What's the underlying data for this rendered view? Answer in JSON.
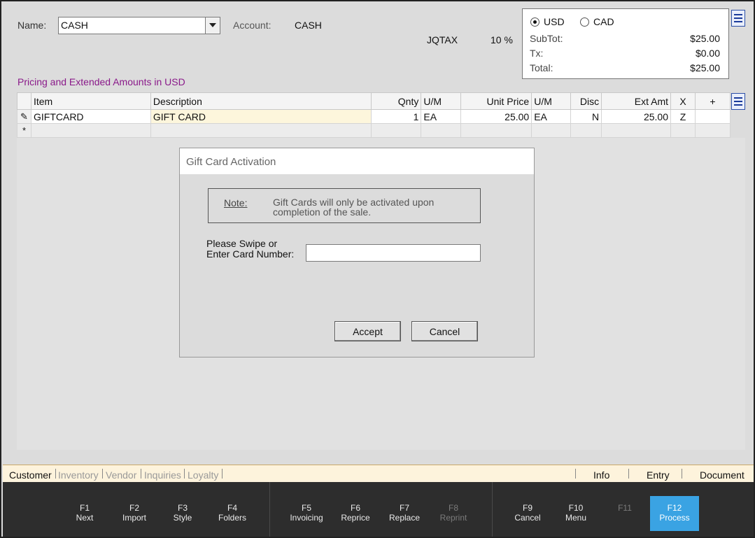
{
  "header": {
    "name_label": "Name:",
    "name_value": "CASH",
    "account_label": "Account:",
    "account_value": "CASH",
    "tax_name": "JQTAX",
    "tax_rate": "10 %"
  },
  "currency": {
    "options": [
      {
        "label": "USD",
        "selected": true
      },
      {
        "label": "CAD",
        "selected": false
      }
    ],
    "subtotal_label": "SubTot:",
    "subtotal_value": "$25.00",
    "tax_label": "Tx:",
    "tax_value": "$0.00",
    "total_label": "Total:",
    "total_value": "$25.00"
  },
  "pricing_caption": "Pricing and Extended Amounts in USD",
  "grid": {
    "columns": [
      "Item",
      "Description",
      "Qnty",
      "U/M",
      "Unit Price",
      "U/M",
      "Disc",
      "Ext Amt",
      "X",
      "+"
    ],
    "rows": [
      {
        "marker": "✎",
        "item": "GIFTCARD",
        "description": "GIFT CARD",
        "qnty": "1",
        "um": "EA",
        "unit_price": "25.00",
        "um2": "EA",
        "disc": "N",
        "ext_amt": "25.00",
        "x": "Z",
        "plus": ""
      }
    ],
    "new_row_marker": "*"
  },
  "dialog": {
    "title": "Gift Card Activation",
    "note_label": "Note:",
    "note_text": "Gift Cards will only be activated upon completion of the sale.",
    "prompt_line1": "Please Swipe or",
    "prompt_line2": "Enter Card Number:",
    "card_number_value": "",
    "accept_label": "Accept",
    "cancel_label": "Cancel"
  },
  "tabs": {
    "left": [
      {
        "label": "Customer",
        "active": true
      },
      {
        "label": "Inventory",
        "active": false
      },
      {
        "label": "Vendor",
        "active": false
      },
      {
        "label": "Inquiries",
        "active": false
      },
      {
        "label": "Loyalty",
        "active": false
      }
    ],
    "right": [
      "Info",
      "Entry",
      "Document"
    ]
  },
  "fkeys": [
    {
      "key": "F1",
      "label": "Next",
      "enabled": true
    },
    {
      "key": "F2",
      "label": "Import",
      "enabled": true
    },
    {
      "key": "F3",
      "label": "Style",
      "enabled": true
    },
    {
      "key": "F4",
      "label": "Folders",
      "enabled": true
    },
    {
      "key": "F5",
      "label": "Invoicing",
      "enabled": true
    },
    {
      "key": "F6",
      "label": "Reprice",
      "enabled": true
    },
    {
      "key": "F7",
      "label": "Replace",
      "enabled": true
    },
    {
      "key": "F8",
      "label": "Reprint",
      "enabled": false
    },
    {
      "key": "F9",
      "label": "Cancel",
      "enabled": true
    },
    {
      "key": "F10",
      "label": "Menu",
      "enabled": true
    },
    {
      "key": "F11",
      "label": "",
      "enabled": false
    },
    {
      "key": "F12",
      "label": "Process",
      "enabled": true,
      "highlighted": true
    }
  ],
  "colors": {
    "caption": "#8a1a8a",
    "highlight_button": "#3aa3e3",
    "selected_cell": "#fdf6dc",
    "tab_bar": "#fdf3dc",
    "fkey_bar": "#2d2d2d"
  },
  "icons": {
    "header_menu": "hamburger-menu-icon",
    "grid_menu": "hamburger-menu-icon",
    "edit_row": "pencil-icon",
    "combo_dropdown": "chevron-down-icon"
  }
}
